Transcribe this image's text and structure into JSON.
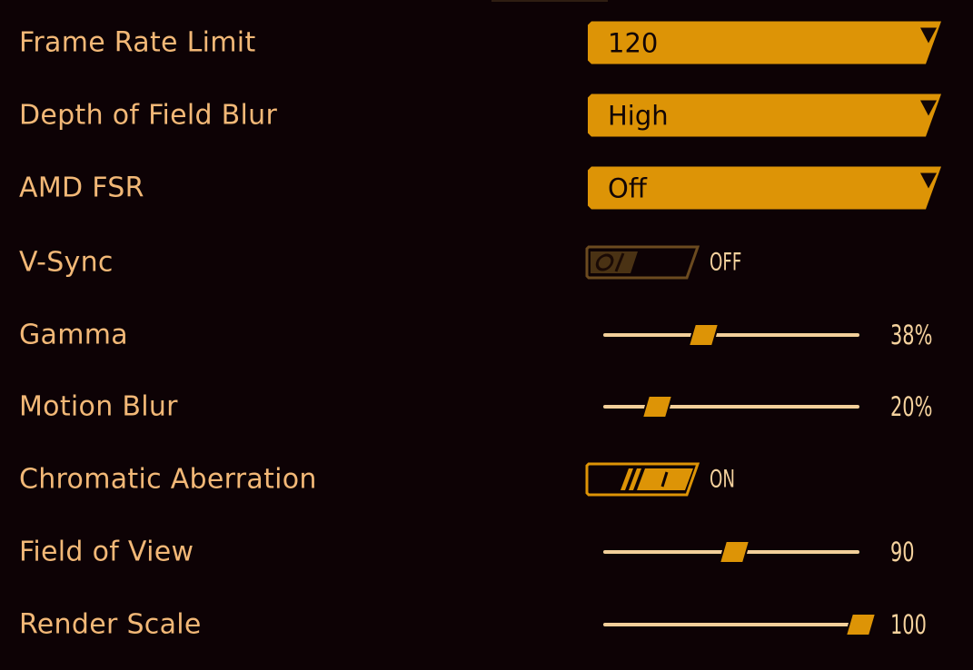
{
  "theme": {
    "accent": "#dd9406",
    "label_color": "#f2b877",
    "value_color": "#f5d29e",
    "background": "#0d0205"
  },
  "settings": {
    "frame_rate_limit": {
      "label": "Frame Rate Limit",
      "type": "dropdown",
      "value": "120"
    },
    "depth_of_field_blur": {
      "label": "Depth of Field Blur",
      "type": "dropdown",
      "value": "High"
    },
    "amd_fsr": {
      "label": "AMD FSR",
      "type": "dropdown",
      "value": "Off"
    },
    "v_sync": {
      "label": "V-Sync",
      "type": "toggle",
      "state": false,
      "value_text": "OFF"
    },
    "gamma": {
      "label": "Gamma",
      "type": "slider",
      "fraction": 0.38,
      "value_text": "38%"
    },
    "motion_blur": {
      "label": "Motion Blur",
      "type": "slider",
      "fraction": 0.2,
      "value_text": "20%"
    },
    "chromatic_aberration": {
      "label": "Chromatic Aberration",
      "type": "toggle",
      "state": true,
      "value_text": "ON"
    },
    "field_of_view": {
      "label": "Field of View",
      "type": "slider",
      "fraction": 0.5,
      "value_text": "90"
    },
    "render_scale": {
      "label": "Render Scale",
      "type": "slider",
      "fraction": 1.0,
      "value_text": "100"
    }
  }
}
